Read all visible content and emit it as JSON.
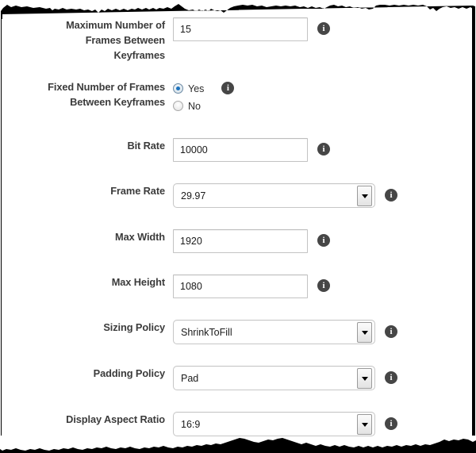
{
  "form": {
    "rows": [
      {
        "id": "max-frames-between-keyframes",
        "label": "Maximum Number of Frames Between Keyframes",
        "label_lines": [
          "Maximum Number of",
          "Frames Between",
          "Keyframes"
        ],
        "control": "text",
        "value": "15",
        "placeholder": "",
        "info_icon": "info-icon",
        "info_label": "i"
      },
      {
        "id": "fixed-number-of-frames-between-keyframes",
        "label": "Fixed Number of Frames Between Keyframes",
        "label_lines": [
          "Fixed Number of Frames",
          "Between Keyframes"
        ],
        "control": "radio",
        "value": "Yes",
        "options": [
          "Yes",
          "No"
        ],
        "info_icon": "info-icon",
        "info_label": "i"
      },
      {
        "id": "bit-rate",
        "label": "Bit Rate",
        "label_lines": [
          "Bit Rate"
        ],
        "control": "text",
        "value": "10000",
        "placeholder": "",
        "info_icon": "info-icon",
        "info_label": "i"
      },
      {
        "id": "frame-rate",
        "label": "Frame Rate",
        "label_lines": [
          "Frame Rate"
        ],
        "control": "select",
        "value": "29.97",
        "info_icon": "info-icon",
        "info_label": "i"
      },
      {
        "id": "max-width",
        "label": "Max Width",
        "label_lines": [
          "Max Width"
        ],
        "control": "text",
        "value": "1920",
        "placeholder": "",
        "info_icon": "info-icon",
        "info_label": "i"
      },
      {
        "id": "max-height",
        "label": "Max Height",
        "label_lines": [
          "Max Height"
        ],
        "control": "text",
        "value": "1080",
        "placeholder": "",
        "info_icon": "info-icon",
        "info_label": "i"
      },
      {
        "id": "sizing-policy",
        "label": "Sizing Policy",
        "label_lines": [
          "Sizing Policy"
        ],
        "control": "select",
        "value": "ShrinkToFill",
        "info_icon": "info-icon",
        "info_label": "i"
      },
      {
        "id": "padding-policy",
        "label": "Padding Policy",
        "label_lines": [
          "Padding Policy"
        ],
        "control": "select",
        "value": "Pad",
        "info_icon": "info-icon",
        "info_label": "i"
      },
      {
        "id": "display-aspect-ratio",
        "label": "Display Aspect Ratio",
        "label_lines": [
          "Display Aspect Ratio"
        ],
        "control": "select",
        "value": "16:9",
        "info_icon": "info-icon",
        "info_label": "i"
      }
    ]
  },
  "colors": {
    "label_text": "#3b3b3b",
    "value_text": "#1a1a1a",
    "input_border": "#c3c3c3",
    "select_border": "#c6c6c6",
    "info_badge": "#464646",
    "radio_dot": "#1c72bd",
    "page_background": "#ffffff",
    "torn_edge": "#000000"
  },
  "decorations": {
    "top_edge": "torn-paper-edge-top",
    "bottom_edge": "torn-paper-edge-bottom",
    "left_edge": "page-border-left",
    "right_edge": "page-border-right"
  }
}
